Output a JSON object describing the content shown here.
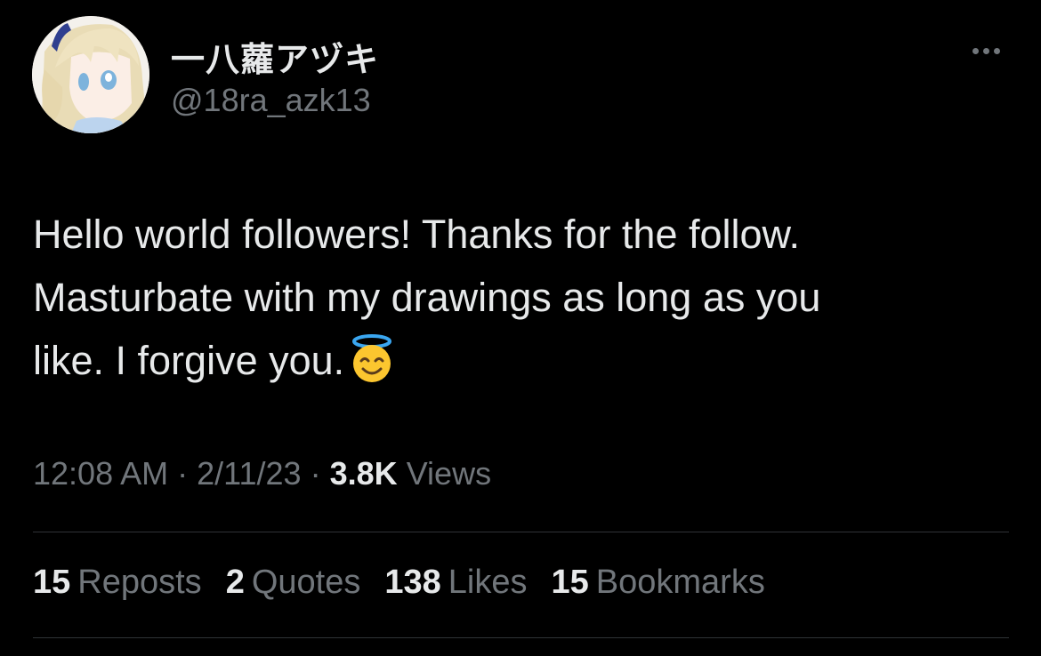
{
  "author": {
    "display_name": "一八蘿アヅキ",
    "handle": "@18ra_azk13",
    "avatar_icon": "anime-girl-avatar"
  },
  "more_icon": "more-horizontal-icon",
  "tweet": {
    "line1": "Hello world followers! Thanks for the follow.",
    "line2": "Masturbate with my drawings as long as you",
    "line3": "like. I forgive you.",
    "emoji_icon": "smiling-face-with-halo-icon"
  },
  "meta": {
    "time": "12:08 AM",
    "date": "2/11/23",
    "separator": "·",
    "views_count": "3.8K",
    "views_label": "Views"
  },
  "stats": {
    "reposts_count": "15",
    "reposts_label": "Reposts",
    "quotes_count": "2",
    "quotes_label": "Quotes",
    "likes_count": "138",
    "likes_label": "Likes",
    "bookmarks_count": "15",
    "bookmarks_label": "Bookmarks"
  },
  "colors": {
    "background": "#000000",
    "primary_text": "#e7e9ea",
    "secondary_text": "#71767b",
    "divider": "#2f3336"
  }
}
